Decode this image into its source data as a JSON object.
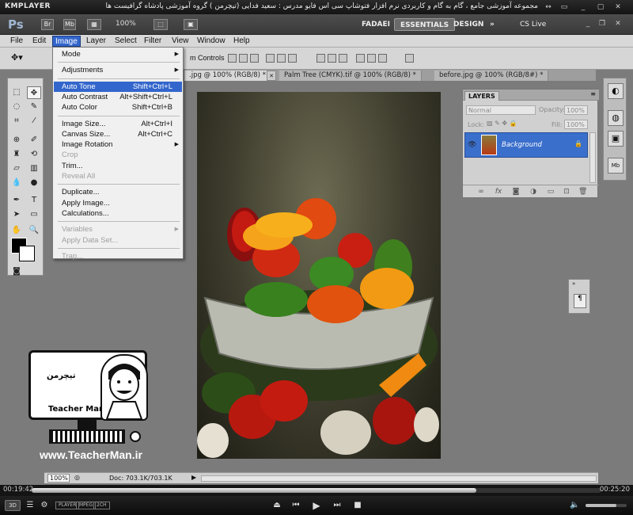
{
  "player": {
    "logo": "KMPLAYER",
    "caption": "مجموعه آموزشی جامع ، گام به گام و کاربردی نرم افزار فتوشاپ سی اس فایو  مدرس : سعید فدایی (تیچرمن ) گروه آموزشی پادشاه گرافیست ها",
    "time_current": "00:19:42",
    "time_total": "00:25:20",
    "progress_fraction": 0.78,
    "volume_fraction": 0.75,
    "badges": [
      "PLAYER",
      "MPEG",
      "2CH"
    ],
    "mode_label": "3D"
  },
  "photoshop": {
    "logo": "Ps",
    "app_icons": [
      "Br",
      "Mb"
    ],
    "zoom": "100%",
    "workspaces": [
      "FADAEI",
      "ESSENTIALS",
      "DESIGN"
    ],
    "cs_live": "CS Live",
    "menus": [
      "File",
      "Edit",
      "Image",
      "Layer",
      "Select",
      "Filter",
      "View",
      "Window",
      "Help"
    ],
    "options_partial": "m Controls",
    "doc_tabs": [
      ".jpg @ 100% (RGB/8) *",
      "Palm Tree (CMYK).tif @ 100% (RGB/8) *",
      "before.jpg @ 100% (RGB/8#) *"
    ],
    "status_zoom": "100%",
    "status_doc": "Doc: 703.1K/703.1K"
  },
  "image_menu": [
    {
      "label": "Mode",
      "shortcut": "",
      "submenu": true,
      "disabled": false
    },
    {
      "sep": true
    },
    {
      "label": "Adjustments",
      "shortcut": "",
      "submenu": true,
      "disabled": false
    },
    {
      "sep": true
    },
    {
      "label": "Auto Tone",
      "shortcut": "Shift+Ctrl+L",
      "submenu": false,
      "disabled": false,
      "highlight": true
    },
    {
      "label": "Auto Contrast",
      "shortcut": "Alt+Shift+Ctrl+L",
      "submenu": false,
      "disabled": false
    },
    {
      "label": "Auto Color",
      "shortcut": "Shift+Ctrl+B",
      "submenu": false,
      "disabled": false
    },
    {
      "sep": true
    },
    {
      "label": "Image Size...",
      "shortcut": "Alt+Ctrl+I",
      "submenu": false,
      "disabled": false
    },
    {
      "label": "Canvas Size...",
      "shortcut": "Alt+Ctrl+C",
      "submenu": false,
      "disabled": false
    },
    {
      "label": "Image Rotation",
      "shortcut": "",
      "submenu": true,
      "disabled": false
    },
    {
      "label": "Crop",
      "shortcut": "",
      "submenu": false,
      "disabled": true
    },
    {
      "label": "Trim...",
      "shortcut": "",
      "submenu": false,
      "disabled": false
    },
    {
      "label": "Reveal All",
      "shortcut": "",
      "submenu": false,
      "disabled": true
    },
    {
      "sep": true
    },
    {
      "label": "Duplicate...",
      "shortcut": "",
      "submenu": false,
      "disabled": false
    },
    {
      "label": "Apply Image...",
      "shortcut": "",
      "submenu": false,
      "disabled": false
    },
    {
      "label": "Calculations...",
      "shortcut": "",
      "submenu": false,
      "disabled": false
    },
    {
      "sep": true
    },
    {
      "label": "Variables",
      "shortcut": "",
      "submenu": true,
      "disabled": true
    },
    {
      "label": "Apply Data Set...",
      "shortcut": "",
      "submenu": false,
      "disabled": true
    },
    {
      "sep": true
    },
    {
      "label": "Trap...",
      "shortcut": "",
      "submenu": false,
      "disabled": true
    }
  ],
  "layers_panel": {
    "tab": "LAYERS",
    "blend_mode": "Normal",
    "opacity_label": "Opacity:",
    "opacity_value": "100%",
    "lock_label": "Lock:",
    "fill_label": "Fill:",
    "fill_value": "100%",
    "layer_name": "Background"
  },
  "watermark": {
    "brand_fa": "تیچرمن",
    "brand_en": "Teacher Man",
    "url": "www.TeacherMan.ir"
  }
}
